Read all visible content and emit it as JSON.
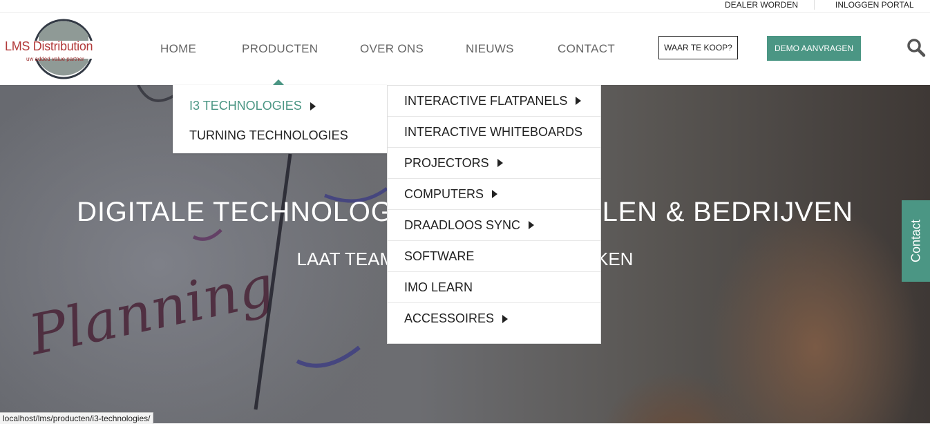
{
  "topbar": {
    "dealer": "DEALER WORDEN",
    "portal": "INLOGGEN PORTAL"
  },
  "logo": {
    "name": "LMS Distribution",
    "tagline": "uw added value partner"
  },
  "nav": [
    "HOME",
    "PRODUCTEN",
    "OVER ONS",
    "NIEUWS",
    "CONTACT"
  ],
  "buttons": {
    "buy": "WAAR TE KOOP?",
    "demo": "DEMO AANVRAGEN"
  },
  "hero": {
    "title": "DIGITALE TECHNOLOGIE VOOR SCHOLEN & BEDRIJVEN",
    "subtitle": "LAAT TEAMS ANDERS SAMENWERKEN",
    "scribble": "Planning"
  },
  "submenu_level1": [
    {
      "label": "I3 TECHNOLOGIES",
      "has_sub": true,
      "active": true
    },
    {
      "label": "TURNING TECHNOLOGIES",
      "has_sub": false,
      "active": false
    }
  ],
  "submenu_level2": [
    {
      "label": "INTERACTIVE FLATPANELS",
      "has_sub": true
    },
    {
      "label": "INTERACTIVE WHITEBOARDS",
      "has_sub": false
    },
    {
      "label": "PROJECTORS",
      "has_sub": true
    },
    {
      "label": "COMPUTERS",
      "has_sub": true
    },
    {
      "label": "DRAADLOOS SYNC",
      "has_sub": true
    },
    {
      "label": "SOFTWARE",
      "has_sub": false
    },
    {
      "label": "IMO LEARN",
      "has_sub": false
    },
    {
      "label": "ACCESSOIRES",
      "has_sub": true
    }
  ],
  "contact_tab": "Contact",
  "status_url": "localhost/lms/producten/i3-technologies/",
  "colors": {
    "accent": "#4b9684",
    "logo_red": "#b23a3a"
  },
  "icons": {
    "search": "search-icon",
    "submenu_arrow": "caret-right-icon"
  }
}
